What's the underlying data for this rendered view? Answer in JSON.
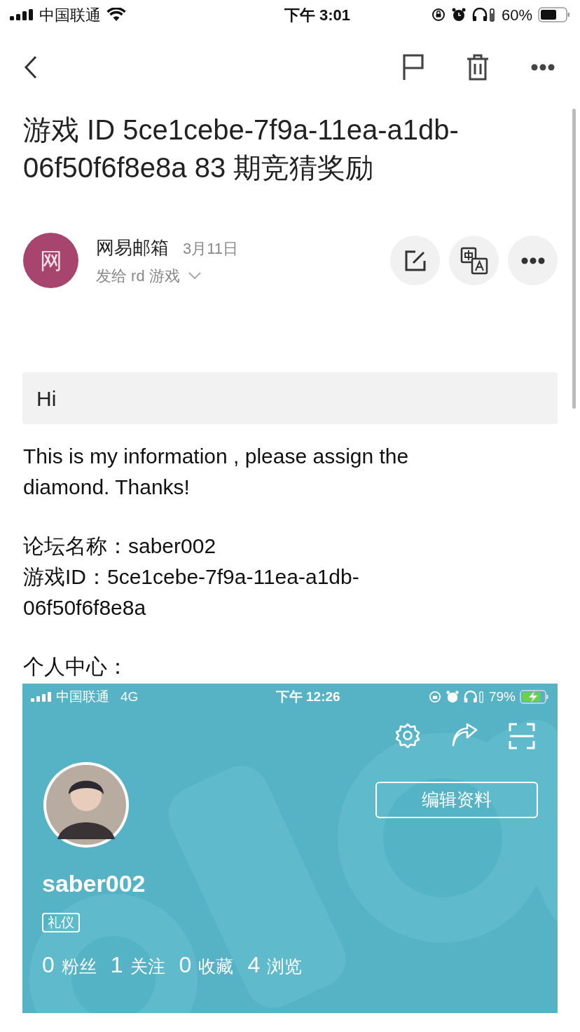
{
  "status_bar": {
    "carrier": "中国联通",
    "time": "下午 3:01",
    "battery": "60%"
  },
  "subject": "游戏 ID 5ce1cebe-7f9a-11ea-a1db-06f50f6f8e8a 83 期竞猜奖励",
  "sender": {
    "avatar": "网",
    "name": "网易邮箱",
    "date": "3月11日",
    "recipient": "发给 rd 游戏"
  },
  "body": {
    "greeting": "Hi",
    "paragraphs": [
      [
        "This is my information , please assign the diamond. Thanks!"
      ],
      [
        "论坛名称：saber002",
        "游戏ID：5ce1cebe-7f9a-11ea-a1db-06f50f6f8e8a"
      ],
      [
        "个人中心："
      ]
    ]
  },
  "attachment_screenshot": {
    "status_bar": {
      "carrier": "中国联通",
      "network": "4G",
      "time": "下午 12:26",
      "battery": "79%"
    },
    "username": "saber002",
    "edit_button": "编辑资料",
    "tag": "礼仪",
    "stats": [
      {
        "count": "0",
        "label": "粉丝"
      },
      {
        "count": "1",
        "label": "关注"
      },
      {
        "count": "0",
        "label": "收藏"
      },
      {
        "count": "4",
        "label": "浏览"
      }
    ]
  }
}
